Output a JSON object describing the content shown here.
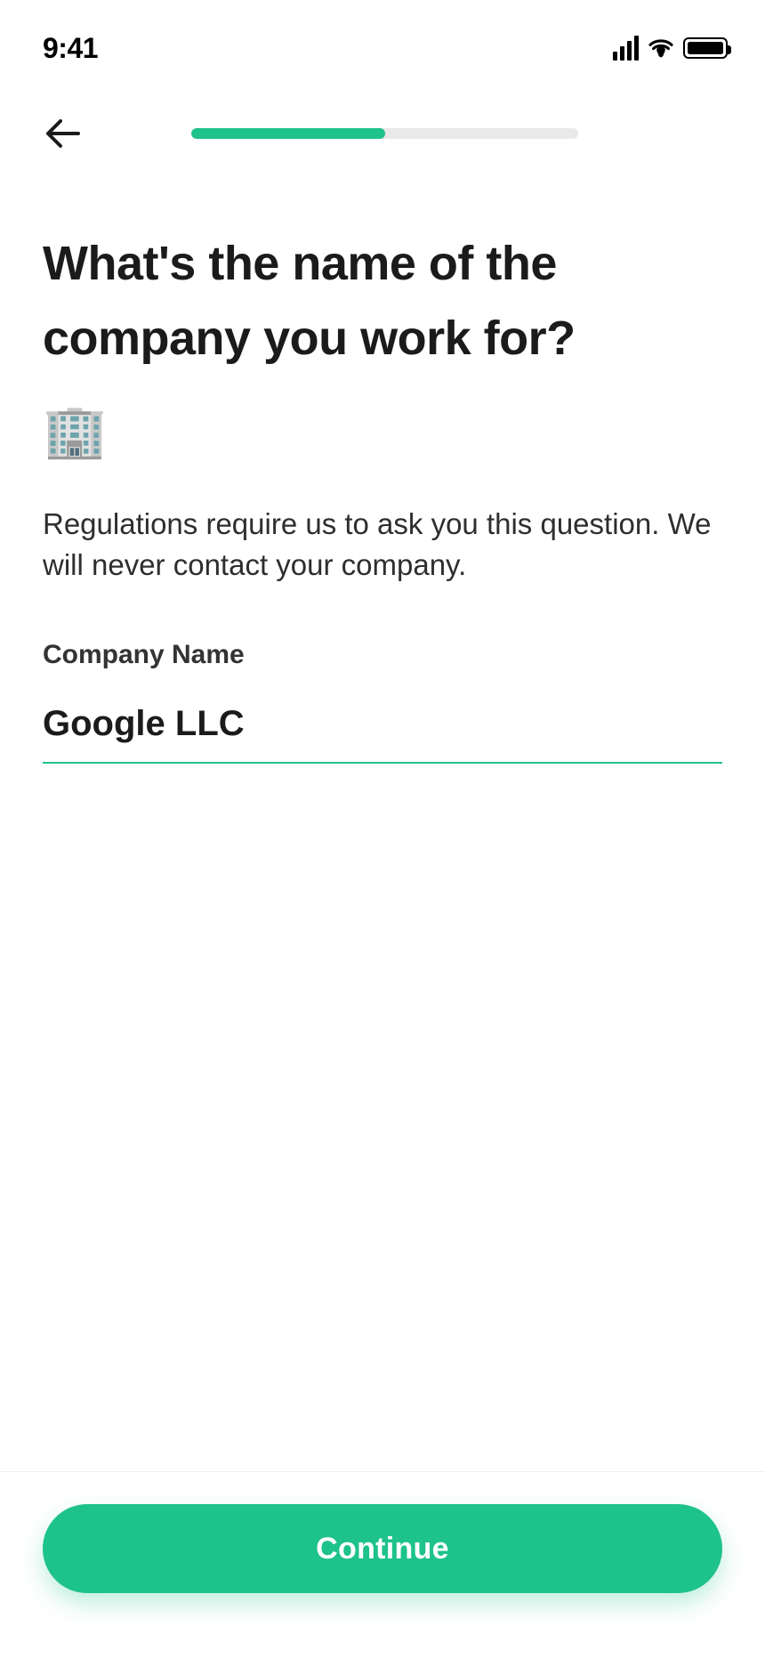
{
  "status": {
    "time": "9:41"
  },
  "progress": {
    "percent": 50
  },
  "page": {
    "title_line1": "What's the name of the",
    "title_line2": "company you work for?",
    "emoji": "🏢",
    "subtitle": "Regulations require us to ask you this question. We will never contact your company."
  },
  "field": {
    "label": "Company Name",
    "value": "Google LLC",
    "placeholder": ""
  },
  "actions": {
    "continue": "Continue"
  },
  "colors": {
    "accent": "#1ec28b"
  }
}
